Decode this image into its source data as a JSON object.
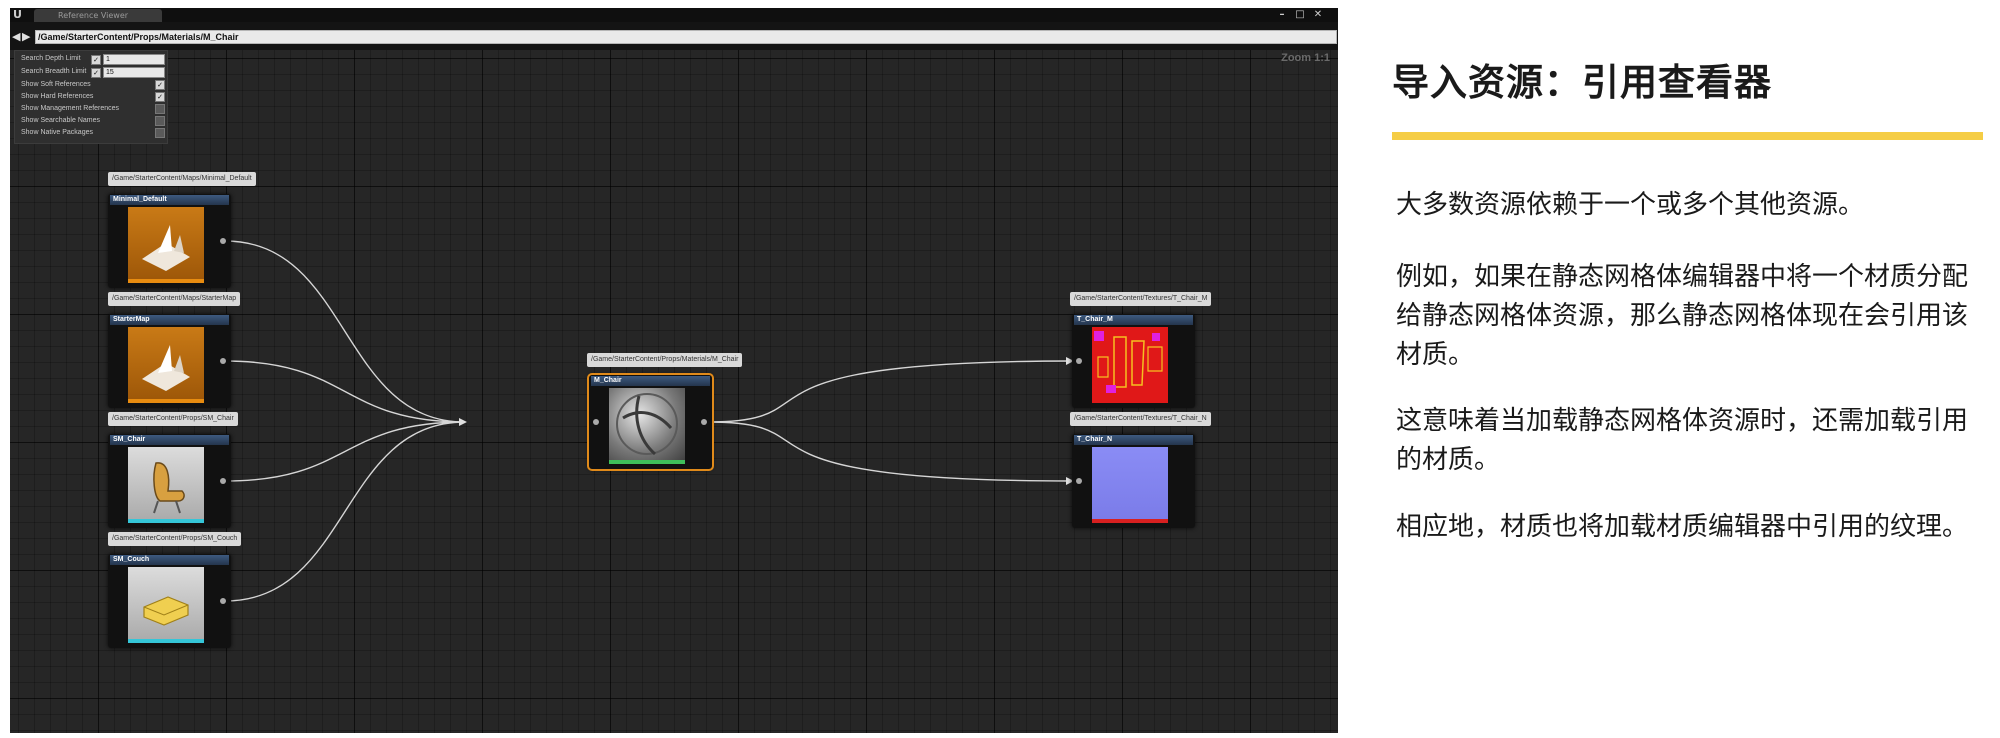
{
  "editor": {
    "window_tab": "Reference Viewer",
    "path": "/Game/StarterContent/Props/Materials/M_Chair",
    "zoom": "Zoom 1:1",
    "settings": {
      "search_depth_label": "Search Depth Limit",
      "search_depth_value": "1",
      "search_breadth_label": "Search Breadth Limit",
      "search_breadth_value": "15",
      "options": [
        {
          "label": "Show Soft References",
          "checked": true
        },
        {
          "label": "Show Hard References",
          "checked": true
        },
        {
          "label": "Show Management References",
          "checked": false
        },
        {
          "label": "Show Searchable Names",
          "checked": false
        },
        {
          "label": "Show Native Packages",
          "checked": false
        }
      ]
    },
    "nodes": {
      "minimal_default": {
        "path": "/Game/StarterContent/Maps/Minimal_Default",
        "name": "Minimal_Default"
      },
      "starter_map": {
        "path": "/Game/StarterContent/Maps/StarterMap",
        "name": "StarterMap"
      },
      "sm_chair": {
        "path": "/Game/StarterContent/Props/SM_Chair",
        "name": "SM_Chair"
      },
      "sm_couch": {
        "path": "/Game/StarterContent/Props/SM_Couch",
        "name": "SM_Couch"
      },
      "m_chair": {
        "path": "/Game/StarterContent/Props/Materials/M_Chair",
        "name": "M_Chair"
      },
      "t_chair_m": {
        "path": "/Game/StarterContent/Textures/T_Chair_M",
        "name": "T_Chair_M"
      },
      "t_chair_n": {
        "path": "/Game/StarterContent/Textures/T_Chair_N",
        "name": "T_Chair_N"
      }
    }
  },
  "slide": {
    "title": "导入资源：引用查看器",
    "accent_color": "#f5cd45",
    "paragraphs": [
      "大多数资源依赖于一个或多个其他资源。",
      "例如，如果在静态网格体编辑器中将一个材质分配给静态网格体资源，那么静态网格体现在会引用该材质。",
      "这意味着当加载静态网格体资源时，还需加载引用的材质。",
      "相应地，材质也将加载材质编辑器中引用的纹理。"
    ]
  }
}
